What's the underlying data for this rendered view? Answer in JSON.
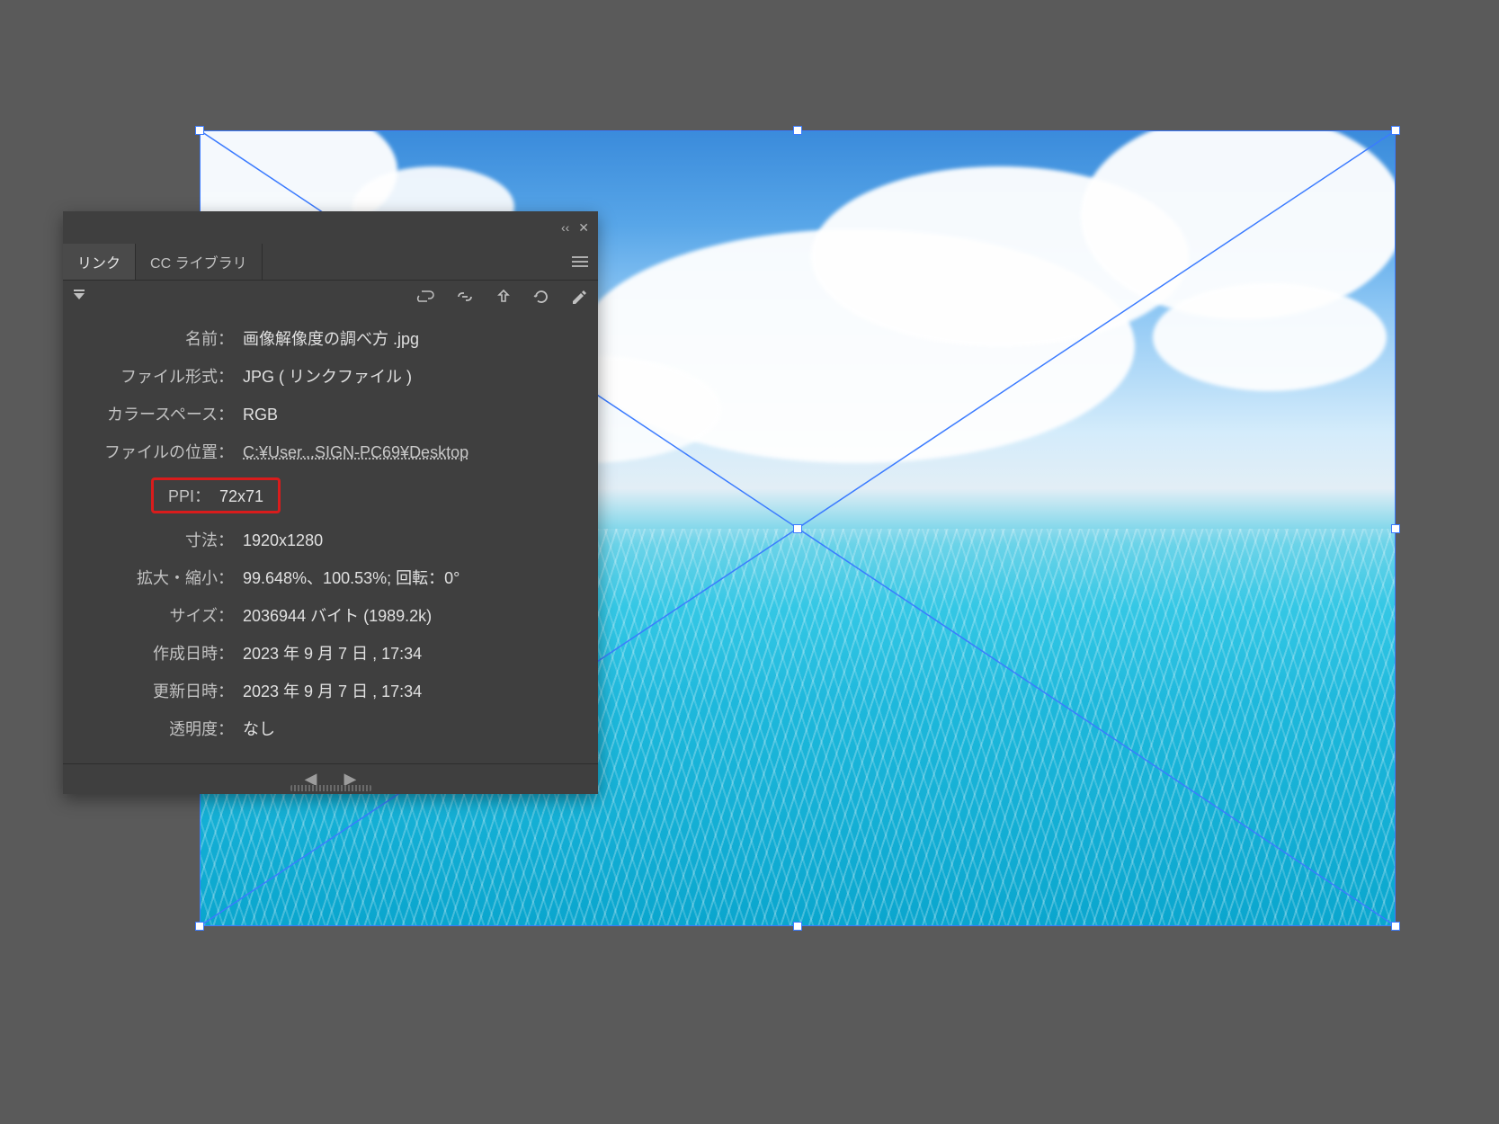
{
  "panel": {
    "tabs": {
      "links": "リンク",
      "libraries": "CC ライブラリ"
    },
    "rows": {
      "name": {
        "label": "名前：",
        "value": "画像解像度の調べ方 .jpg"
      },
      "format": {
        "label": "ファイル形式：",
        "value": "JPG ( リンクファイル )"
      },
      "colorspace": {
        "label": "カラースペース：",
        "value": "RGB"
      },
      "location": {
        "label": "ファイルの位置：",
        "value": "C:¥User...SIGN-PC69¥Desktop"
      },
      "ppi": {
        "label": "PPI：",
        "value": "72x71"
      },
      "dimensions": {
        "label": "寸法：",
        "value": "1920x1280"
      },
      "scale": {
        "label": "拡大・縮小：",
        "value": "99.648%、100.53%; 回転：0°"
      },
      "size": {
        "label": "サイズ：",
        "value": "2036944 バイト (1989.2k)"
      },
      "created": {
        "label": "作成日時：",
        "value": "2023 年 9 月 7 日 , 17:34"
      },
      "modified": {
        "label": "更新日時：",
        "value": "2023 年 9 月 7 日 , 17:34"
      },
      "transparency": {
        "label": "透明度：",
        "value": "なし"
      }
    },
    "ctrl": {
      "collapse": "‹‹",
      "close": "✕"
    }
  }
}
